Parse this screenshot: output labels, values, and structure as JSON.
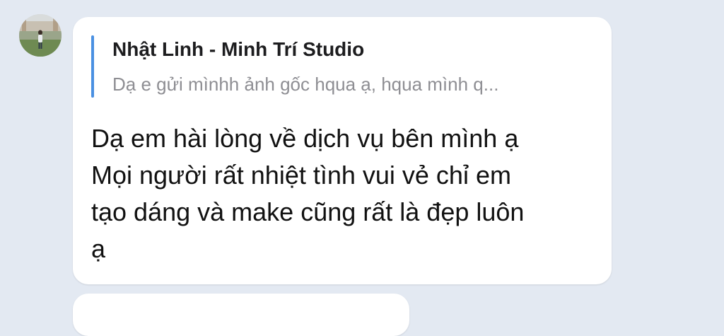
{
  "reply": {
    "quoted_author": "Nhật Linh - Minh Trí Studio",
    "quoted_text": "Dạ e gửi mìnhh ảnh gốc hqua ạ, hqua mình q...",
    "accent_color": "#4a90e2"
  },
  "message": {
    "lines": [
      "Dạ em hài lòng về dịch vụ bên mình ạ",
      "Mọi người rất nhiệt tình vui vẻ chỉ em",
      "tạo dáng và make cũng rất là đẹp luôn",
      "ạ"
    ]
  }
}
